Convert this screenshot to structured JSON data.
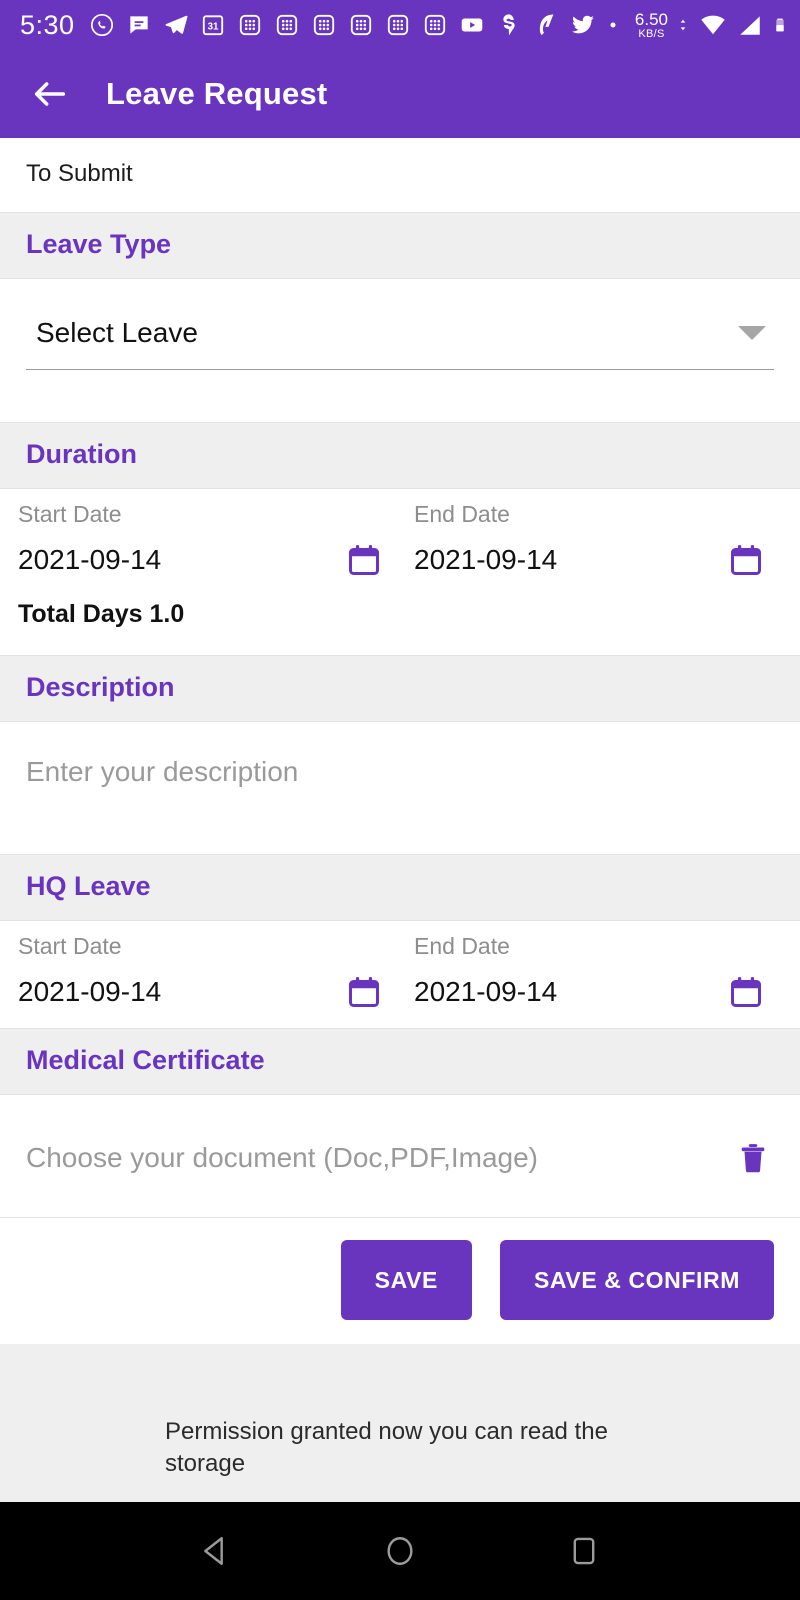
{
  "statusbar": {
    "time": "5:30",
    "icons": [
      "whatsapp-icon",
      "message-icon",
      "telegram-icon",
      "calendar-31-icon",
      "app-grid-icon",
      "app-grid-icon",
      "app-grid-icon",
      "app-grid-icon",
      "app-grid-icon",
      "app-grid-icon",
      "youtube-icon",
      "swiggy-icon",
      "paytm-icon",
      "twitter-icon",
      "dot-icon"
    ],
    "net_speed_value": "6.50",
    "net_speed_unit": "KB/S",
    "right_icons": [
      "data-transfer-icon",
      "wifi-icon",
      "signal-icon",
      "battery-icon"
    ]
  },
  "appbar": {
    "back_icon": "arrow-left-icon",
    "title": "Leave Request"
  },
  "status_row": {
    "label": "To Submit"
  },
  "sections": {
    "leave_type": {
      "title": "Leave Type",
      "dropdown_value": "Select Leave",
      "dropdown_icon": "chevron-down-icon"
    },
    "duration": {
      "title": "Duration",
      "start_label": "Start Date",
      "end_label": "End Date",
      "start_value": "2021-09-14",
      "end_value": "2021-09-14",
      "calendar_icon": "calendar-icon",
      "total_days": "Total Days 1.0"
    },
    "description": {
      "title": "Description",
      "placeholder": "Enter your description",
      "value": ""
    },
    "hq_leave": {
      "title": "HQ Leave",
      "start_label": "Start Date",
      "end_label": "End Date",
      "start_value": "2021-09-14",
      "end_value": "2021-09-14",
      "calendar_icon": "calendar-icon"
    },
    "medical_certificate": {
      "title": "Medical Certificate",
      "placeholder": "Choose your document (Doc,PDF,Image)",
      "value": "",
      "delete_icon": "trash-icon"
    }
  },
  "actions": {
    "save_label": "SAVE",
    "save_confirm_label": "SAVE & CONFIRM"
  },
  "toast": {
    "message": "Permission granted now you can read the storage"
  },
  "navbar": {
    "back_icon": "nav-back-triangle-icon",
    "home_icon": "nav-home-circle-icon",
    "recents_icon": "nav-recents-square-icon"
  },
  "colors": {
    "primary": "#6A35BE",
    "section_bg": "#EFEFEF",
    "surface": "#FFFFFF",
    "hint_text": "#9A9A9A"
  }
}
